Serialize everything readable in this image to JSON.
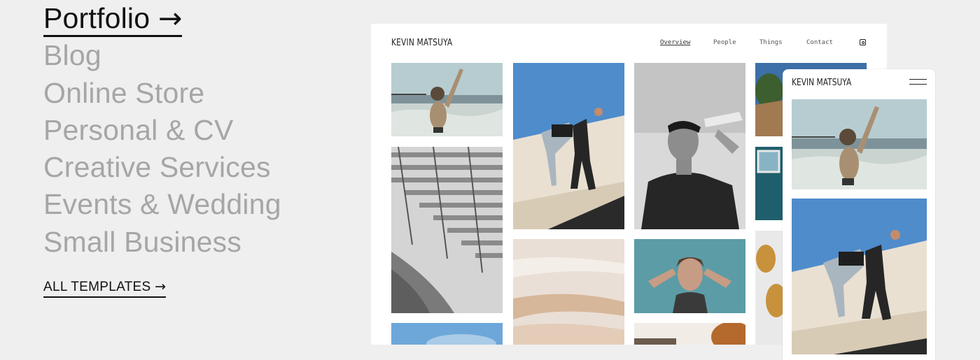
{
  "categories": [
    {
      "label": "Portfolio",
      "arrow": "→",
      "active": true
    },
    {
      "label": "Blog"
    },
    {
      "label": "Online Store"
    },
    {
      "label": "Personal & CV"
    },
    {
      "label": "Creative Services"
    },
    {
      "label": "Events & Wedding"
    },
    {
      "label": "Small Business"
    }
  ],
  "all_templates": {
    "label": "ALL TEMPLATES",
    "arrow": "→"
  },
  "preview": {
    "site_title": "KEVIN MATSUYA",
    "nav": [
      "Overview",
      "People",
      "Things",
      "Contact"
    ],
    "current_nav": "Overview",
    "social_icon": "instagram-icon"
  },
  "mobile": {
    "site_title": "KEVIN MATSUYA",
    "menu_icon": "hamburger-menu-icon"
  },
  "colors": {
    "page_bg": "#efefef",
    "active_text": "#111111",
    "inactive_text": "#a6a6a6"
  }
}
